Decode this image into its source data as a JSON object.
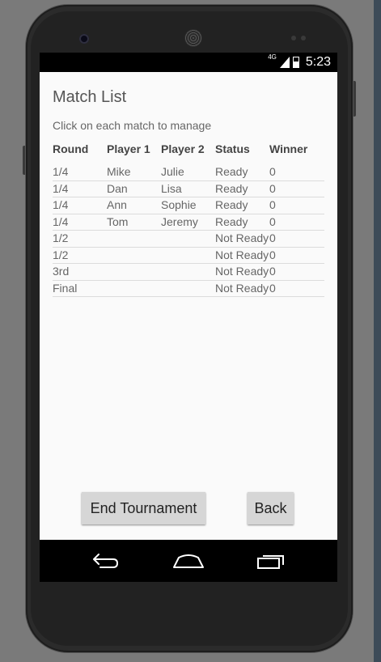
{
  "status_bar": {
    "network": "4G",
    "time": "5:23"
  },
  "page": {
    "title": "Match List",
    "subtitle": "Click on each match to manage"
  },
  "table": {
    "headers": [
      "Round",
      "Player 1",
      "Player 2",
      "Status",
      "Winner"
    ],
    "rows": [
      [
        "1/4",
        "Mike",
        "Julie",
        "Ready",
        "0"
      ],
      [
        "1/4",
        "Dan",
        "Lisa",
        "Ready",
        "0"
      ],
      [
        "1/4",
        "Ann",
        "Sophie",
        "Ready",
        "0"
      ],
      [
        "1/4",
        "Tom",
        "Jeremy",
        "Ready",
        "0"
      ],
      [
        "1/2",
        "",
        "",
        "Not Ready",
        "0"
      ],
      [
        "1/2",
        "",
        "",
        "Not Ready",
        "0"
      ],
      [
        "3rd",
        "",
        "",
        "Not Ready",
        "0"
      ],
      [
        "Final",
        "",
        "",
        "Not Ready",
        "0"
      ]
    ]
  },
  "buttons": {
    "end_tournament": "End Tournament",
    "back": "Back"
  },
  "nav": {
    "icons": [
      "back-icon",
      "home-icon",
      "recents-icon"
    ]
  },
  "colors": {
    "screen_bg": "#fafafa",
    "button_bg": "#d6d6d6",
    "text": "#666666"
  }
}
